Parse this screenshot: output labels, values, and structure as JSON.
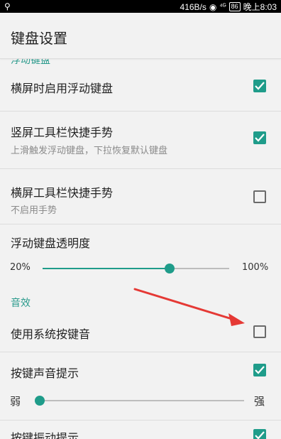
{
  "status_bar": {
    "network_speed": "416B/s",
    "signal": "⁴ᴳ",
    "battery": "86",
    "time": "晚上8:03"
  },
  "header": {
    "title": "键盘设置"
  },
  "floating_section_peek": "浮动键盘",
  "settings": {
    "landscape_floating": {
      "label": "横屏时启用浮动键盘",
      "checked": true
    },
    "portrait_toolbar_gesture": {
      "label": "竖屏工具栏快捷手势",
      "sub": "上滑触发浮动键盘，下拉恢复默认键盘",
      "checked": true
    },
    "landscape_toolbar_gesture": {
      "label": "横屏工具栏快捷手势",
      "sub": "不启用手势",
      "checked": false
    },
    "floating_opacity": {
      "label": "浮动键盘透明度",
      "min_label": "20%",
      "max_label": "100%",
      "value_fraction": 0.68
    }
  },
  "sound_section": {
    "header": "音效"
  },
  "sound": {
    "system_key_sound": {
      "label": "使用系统按键音",
      "checked": false
    },
    "key_sound_prompt": {
      "label": "按键声音提示",
      "checked": true
    },
    "volume": {
      "min_label": "弱",
      "max_label": "强",
      "value_fraction": 0.0
    },
    "key_vibration": {
      "label": "按键振动提示",
      "checked": true
    }
  },
  "colors": {
    "accent": "#1f9c8a",
    "annotation_arrow": "#e53935"
  }
}
